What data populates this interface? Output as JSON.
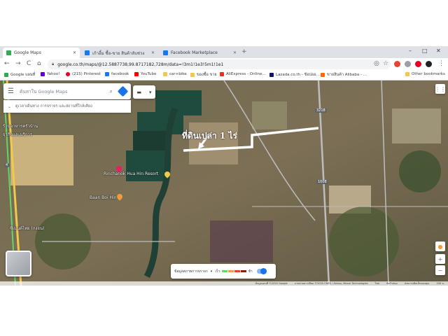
{
  "tabs": [
    {
      "label": "Google Maps",
      "fav_color": "#34a853",
      "active": true
    },
    {
      "label": "เก้าอี้ม ซื้อ-ขาย สินค้าลับช่วง",
      "fav_color": "#1877f2",
      "active": false
    },
    {
      "label": "Facebook Marketplace",
      "fav_color": "#1877f2",
      "active": false
    }
  ],
  "new_tab_glyph": "+",
  "window_controls": {
    "minimize": "–",
    "maximize": "□",
    "close": "✕"
  },
  "toolbar": {
    "back": "←",
    "forward": "→",
    "reload": "C",
    "url": "google.co.th/maps/@12.5887738,99.8717182,728m/data=!3m1!1e3!5m1!1e1"
  },
  "bookmarks": [
    {
      "label": "Google แผนที่",
      "color": "#34a853"
    },
    {
      "label": "Yahoo!",
      "color": "#6001d2"
    },
    {
      "label": "(215) Pinterest",
      "color": "#e60023"
    },
    {
      "label": "facebook",
      "color": "#1877f2"
    },
    {
      "label": "YouTube",
      "color": "#ff0000"
    },
    {
      "label": "car+bike",
      "color": "#f2c94c"
    },
    {
      "label": "ของซื้อ ขาย",
      "color": "#f2c94c"
    },
    {
      "label": "AliExpress - Online...",
      "color": "#e43225"
    },
    {
      "label": "Lazada.co.th - ช้อปออ...",
      "color": "#0f146d"
    },
    {
      "label": "ขายสินค้า Alibaba - ...",
      "color": "#ff6a00"
    }
  ],
  "other_bookmarks": "Other bookmarks",
  "search": {
    "placeholder": "ค้นหาใน Google Maps"
  },
  "suggestion_chip": "ดูเวลาเดินทาง การจราจร และสถานที่ใกล้เคียง",
  "annotation": "ที่ดินเปล่า 1 ไร่",
  "places": [
    {
      "name": "Rinchanok Hua Hin Resort",
      "pin_color": "#e91e63"
    },
    {
      "name": "Baan Boi Hin",
      "pin_color": "#f29b38"
    },
    {
      "name": "ร้านเสื้อผ้า",
      "pin_color": "#f2c94c"
    }
  ],
  "left_labels": [
    "ร้านอาหารครัวบ้าน",
    "ธุรกิจและบริการ"
  ],
  "bottom_left_label": "ซีเมนต์ไทย (กงอน)",
  "road_labels": [
    "3218",
    "1008",
    "4"
  ],
  "traffic": {
    "label": "ข้อมูลสภาพการจราจร",
    "fast": "เร็ว",
    "slow": "ช้า",
    "colors": [
      "#63d668",
      "#ff974d",
      "#f23c32",
      "#811f1f"
    ]
  },
  "footer": [
    "ข้อมูลแผนที่ ©2020 Google",
    "ภาพถ่ายดาวเทียม ©2020 CNES / Airbus, Maxar Technologies",
    "ไทย",
    "ข้อกำหนด",
    "ส่งความคิดเห็นของคุณ",
    "100 ม."
  ],
  "map_controls": {
    "zoom_in": "+",
    "zoom_out": "−",
    "pegman": "●"
  }
}
